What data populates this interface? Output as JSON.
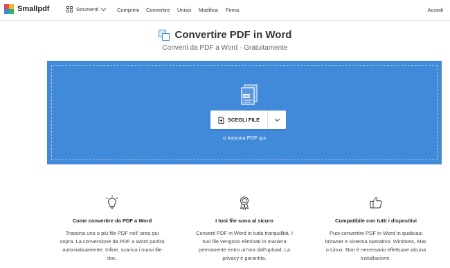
{
  "nav": {
    "logo": "Smallpdf",
    "tools_label": "Strumenti",
    "items": [
      "Comprimi",
      "Convertire",
      "Unisci",
      "Modifica",
      "Firma"
    ],
    "login": "Accedi"
  },
  "header": {
    "title": "Convertire PDF in Word",
    "subtitle": "Converti da PDF a Word - Gratuitamente"
  },
  "dropzone": {
    "button_label": "SCEGLI FILE",
    "drag_hint": "o trascina PDF qui",
    "background": "#418ad9"
  },
  "features": [
    {
      "icon": "lightbulb-icon",
      "title": "Come convertire da PDF a Word",
      "lines": [
        "Trascina uno o più file PDF nell' area qui",
        "sopra. La conversione da PDF a Word partirà",
        "automaticamente. Infine, scarica i nuovi file",
        "doc."
      ]
    },
    {
      "icon": "award-ribbon-icon",
      "title": "I tuoi file sono al sicuro",
      "lines": [
        "Converti PDF in Word in tutta tranquillità. I",
        "tuoi file vengono eliminati in maniera",
        "permanente entro un'ora dall'upload. La",
        "privacy è garantita."
      ]
    },
    {
      "icon": "thumbs-up-icon",
      "title": "Compatibile con tutti i dispositivi",
      "lines": [
        "Puoi convertire PDF in Word in qualsiasi",
        "browser e sistema operativo: Windows, Mac",
        "o Linux. Non è necessario effettuare alcuna",
        "installazione."
      ]
    }
  ]
}
